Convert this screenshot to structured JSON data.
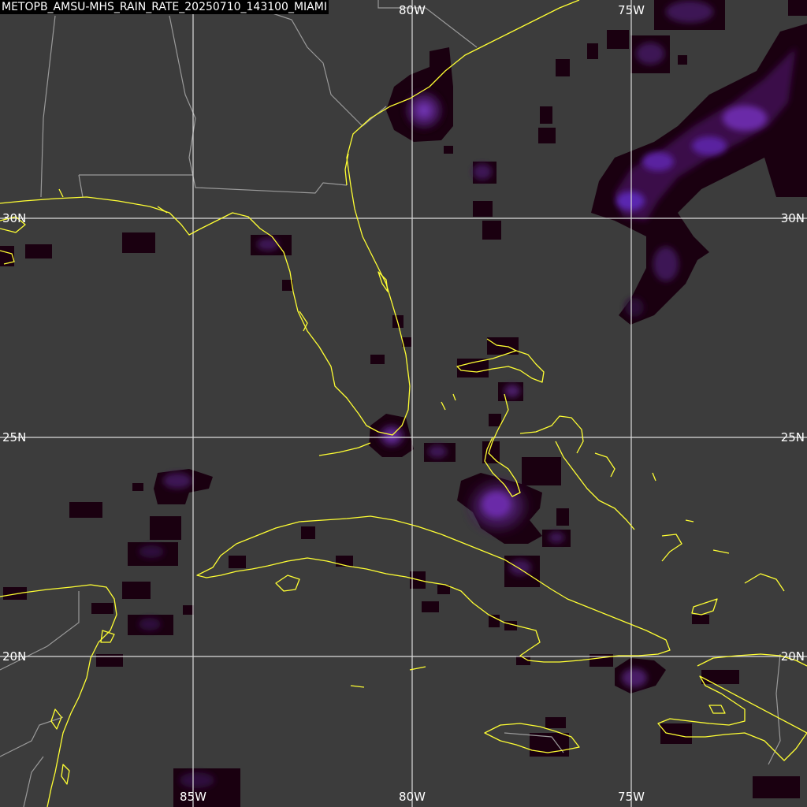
{
  "title": "METOPB_AMSU-MHS_RAIN_RATE_20250710_143100_MIAMI",
  "colors": {
    "background": "#3c3c3c",
    "coastline": "#ffff33",
    "borders": "#9a9a9a",
    "gridlines": "#dcdcdc",
    "rain_low": "#1a0010",
    "rain_mid": "#3d0f4a",
    "rain_high": "#6a2aa8"
  },
  "grid": {
    "longitude_labels_top": [
      "80W",
      "75W"
    ],
    "longitude_labels_bottom": [
      "85W",
      "80W",
      "75W"
    ],
    "latitude_labels_left": [
      "30N",
      "25N",
      "20N"
    ],
    "latitude_labels_right": [
      "30N",
      "25N",
      "20N"
    ]
  }
}
